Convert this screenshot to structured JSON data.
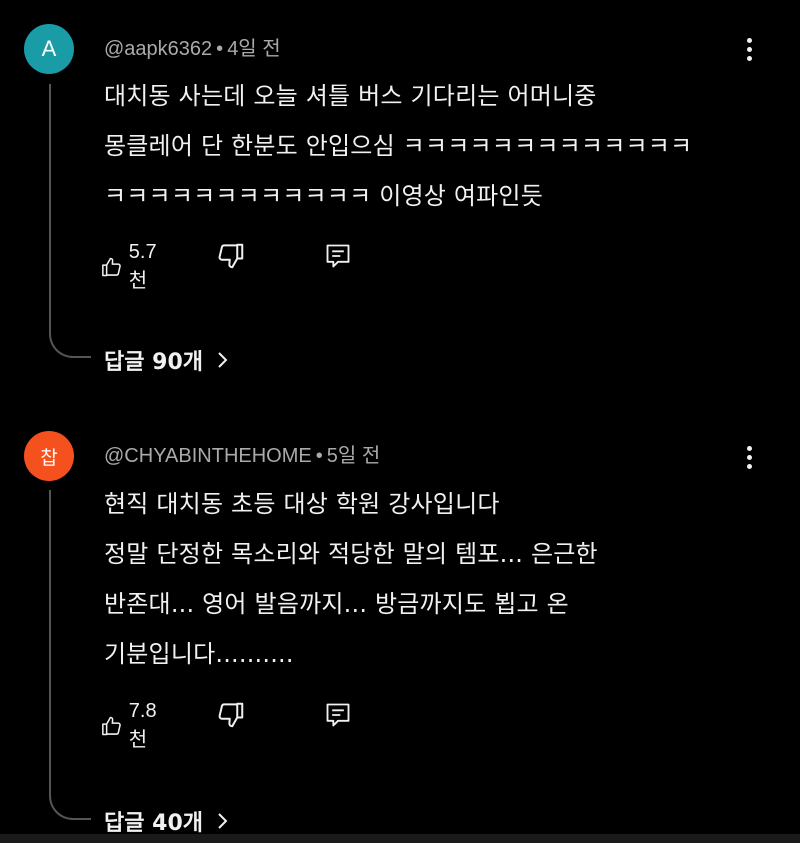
{
  "comments": [
    {
      "avatar_letter": "A",
      "avatar_color": "#1a9ca6",
      "handle": "@aapk6362",
      "time": "4일 전",
      "lines": [
        "대치동 사는데 오늘 셔틀 버스 기다리는 어머니중",
        "몽클레어 단 한분도 안입으심 ㅋㅋㅋㅋㅋㅋㅋㅋㅋㅋㅋㅋㅋ",
        "ㅋㅋㅋㅋㅋㅋㅋㅋㅋㅋㅋㅋ 이영상 여파인듯"
      ],
      "likes": "5.7천",
      "replies": "답글 90개"
    },
    {
      "avatar_letter": "찹",
      "avatar_color": "#f4511e",
      "handle": "@CHYABINTHEHOME",
      "time": "5일 전",
      "lines": [
        "현직 대치동 초등 대상 학원 강사입니다",
        "정말 단정한 목소리와 적당한 말의 템포... 은근한",
        "반존대... 영어 발음까지... 방금까지도 뵙고 온",
        "기분입니다.........."
      ],
      "likes": "7.8천",
      "replies": "답글 40개"
    }
  ],
  "icons": {
    "like": "thumbs-up-icon",
    "dislike": "thumbs-down-icon",
    "reply": "comment-reply-icon",
    "more": "more-vert-icon",
    "chevron": "chevron-right-icon"
  }
}
